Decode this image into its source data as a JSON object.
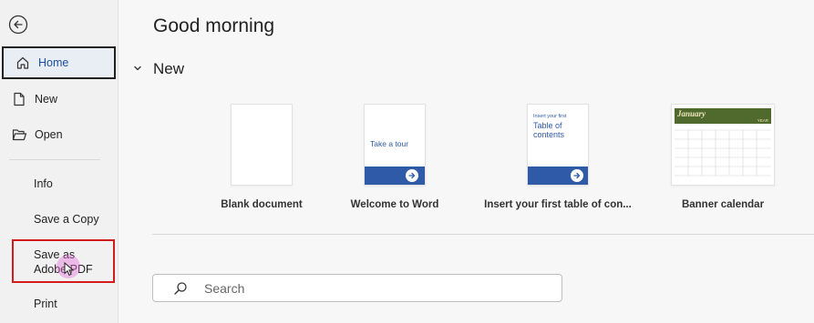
{
  "sidebar": {
    "items": [
      {
        "label": "Home",
        "icon": "home-icon"
      },
      {
        "label": "New",
        "icon": "new-document-icon"
      },
      {
        "label": "Open",
        "icon": "folder-open-icon"
      },
      {
        "label": "Info"
      },
      {
        "label": "Save a Copy"
      },
      {
        "label": "Save as Adobe PDF"
      },
      {
        "label": "Print"
      }
    ]
  },
  "main": {
    "greeting": "Good morning",
    "new_section_title": "New",
    "templates": [
      {
        "label": "Blank document"
      },
      {
        "label": "Welcome to Word",
        "thumb_text": "Take a tour"
      },
      {
        "label": "Insert your first table of con...",
        "thumb_small": "Insert your first",
        "thumb_title": "Table of contents"
      },
      {
        "label": "Banner calendar",
        "thumb_month": "January",
        "thumb_year": "YEAR"
      }
    ],
    "search": {
      "placeholder": "Search"
    }
  },
  "colors": {
    "accent_blue": "#2f5aa8",
    "highlight_red": "#d21b1b",
    "calendar_green": "#4f6a2c"
  }
}
